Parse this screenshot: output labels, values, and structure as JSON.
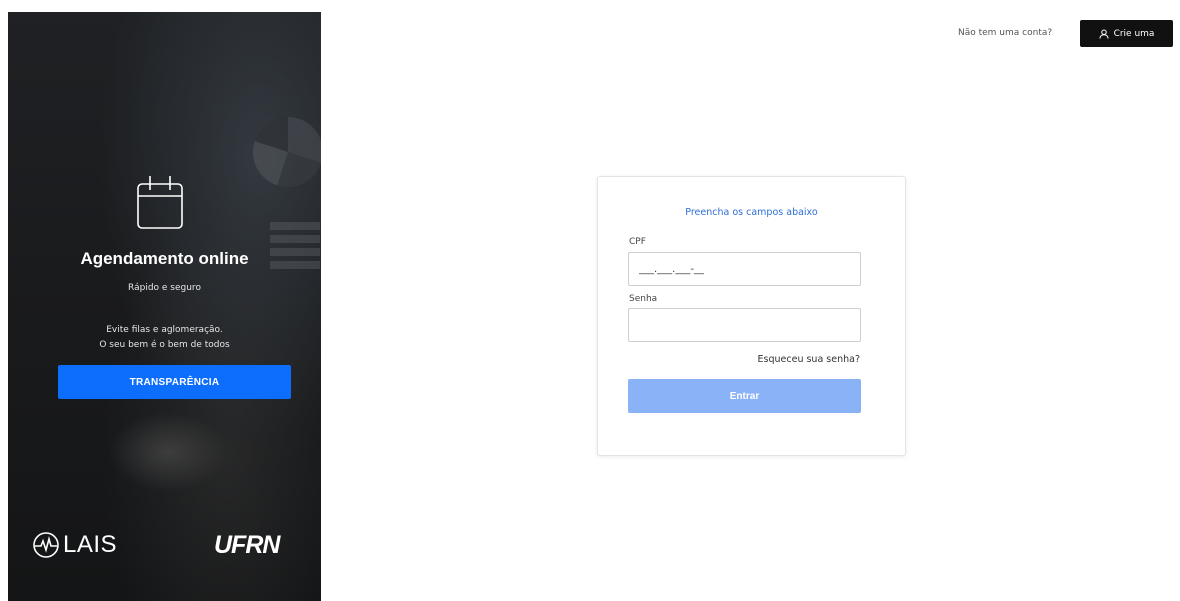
{
  "hero": {
    "title": "Agendamento online",
    "subtitle": "Rápido e seguro",
    "line1": "Evite filas e aglomeração.",
    "line2": "O seu bem é o bem de todos",
    "button_label": "TRANSPARÊNCIA",
    "button_color": "#0d6efd",
    "logo_lais": "LAIS",
    "logo_ufrn": "UFRN"
  },
  "topbar": {
    "no_account_text": "Não tem uma conta?",
    "signup_label": "Crie uma",
    "signup_icon": "user-icon"
  },
  "login": {
    "heading": "Preencha os campos abaixo",
    "cpf_label": "CPF",
    "cpf_value": "___.___.___-__",
    "password_label": "Senha",
    "password_value": "",
    "forgot_label": "Esqueceu sua senha?",
    "submit_label": "Entrar",
    "submit_color": "#8ab2f7",
    "heading_color": "#2f6fd6"
  }
}
